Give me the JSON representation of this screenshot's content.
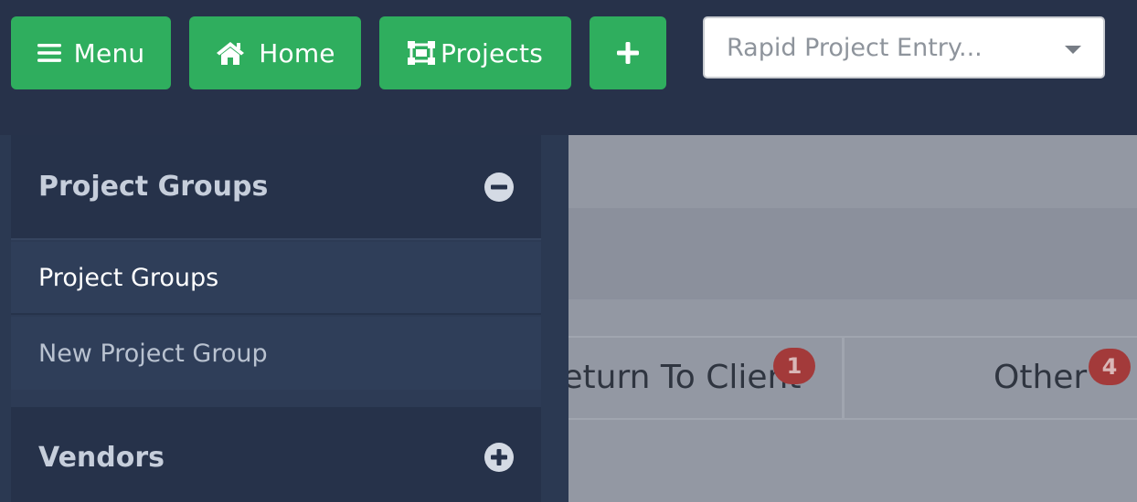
{
  "topbar": {
    "menu_label": "Menu",
    "home_label": "Home",
    "projects_label": "Projects",
    "add_label": "+",
    "rapid_entry_placeholder": "Rapid Project Entry..."
  },
  "sidebar": {
    "sections": [
      {
        "title": "Project Groups",
        "state": "expanded",
        "toggle_icon": "minus-circle-icon",
        "items": [
          {
            "label": "Project Groups"
          },
          {
            "label": "New Project Group"
          }
        ]
      },
      {
        "title": "Vendors",
        "state": "collapsed",
        "toggle_icon": "plus-circle-icon"
      }
    ]
  },
  "main": {
    "tabs": [
      {
        "label": "Return To Client",
        "badge": "1"
      },
      {
        "label": "Other",
        "badge": "4"
      }
    ]
  },
  "colors": {
    "accent_green": "#2fae5e",
    "topbar_bg": "#27324a",
    "sidebar_bg": "#2d3b55",
    "badge_red": "#a33a3a"
  }
}
